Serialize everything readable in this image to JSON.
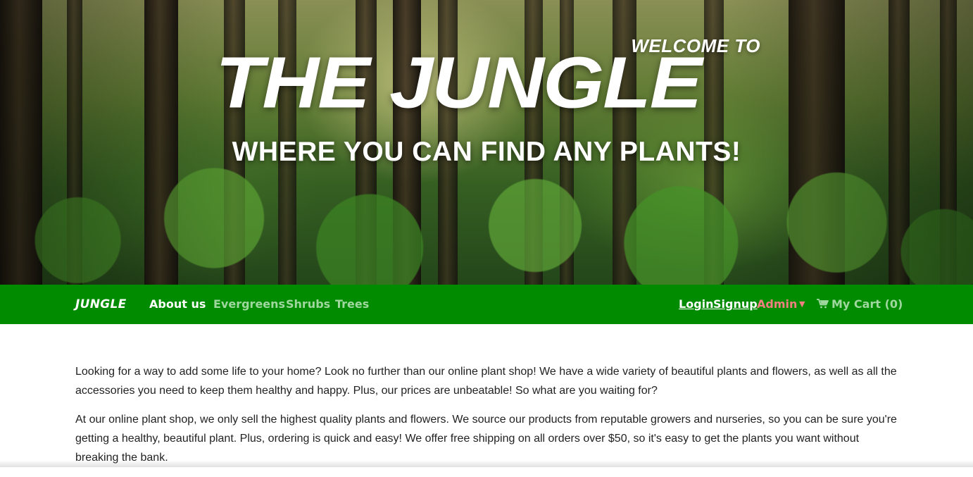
{
  "hero": {
    "welcome": "WELCOME TO",
    "title": "THE JUNGLE",
    "tagline": "WHERE YOU CAN FIND ANY PLANTS!"
  },
  "navbar": {
    "brand": "JUNGLE",
    "about": "About us",
    "categories": [
      "Evergreens",
      "Shrubs",
      "Trees"
    ],
    "login": "Login",
    "signup": "Signup",
    "admin": "Admin",
    "cart": "My Cart (0)"
  },
  "content": {
    "paragraphs": [
      "Looking for a way to add some life to your home? Look no further than our online plant shop! We have a wide variety of beautiful plants and flowers, as well as all the accessories you need to keep them healthy and happy. Plus, our prices are unbeatable! So what are you waiting for?",
      "At our online plant shop, we only sell the highest quality plants and flowers. We source our products from reputable growers and nurseries, so you can be sure you're getting a healthy, beautiful plant. Plus, ordering is quick and easy! We offer free shipping on all orders over $50, so it's easy to get the plants you want without breaking the bank."
    ]
  },
  "icons": {
    "cart": "cart-icon",
    "admin_dropdown": "caret-down-icon"
  },
  "colors": {
    "navbar": "#008b00",
    "nav_muted": "#9fd79f",
    "admin": "#f08080"
  }
}
